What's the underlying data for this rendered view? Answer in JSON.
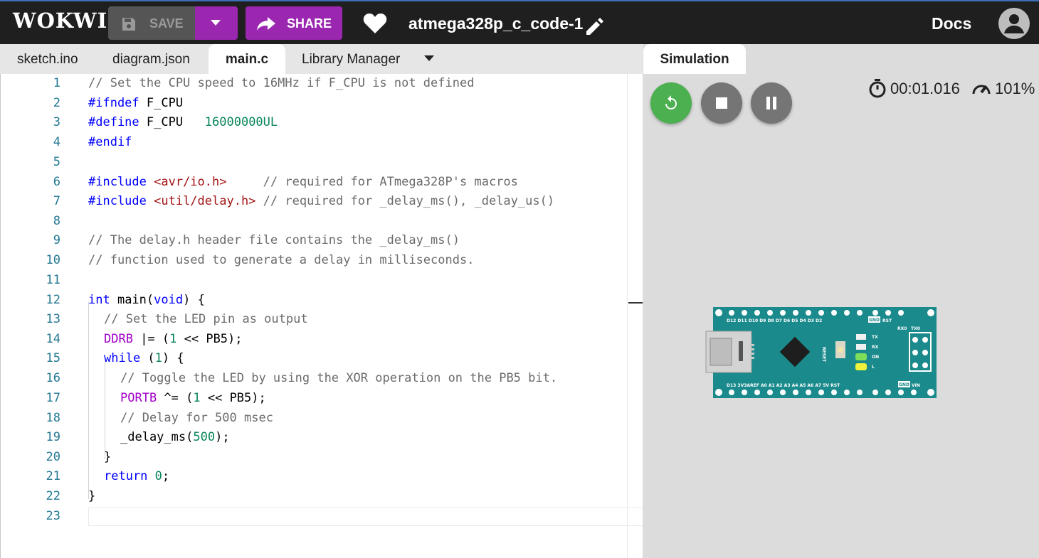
{
  "header": {
    "logo": "WOKWI",
    "save_label": "SAVE",
    "share_label": "SHARE",
    "project_title": "atmega328p_c_code-1",
    "docs_label": "Docs",
    "colors": {
      "bar": "#1f1f1f",
      "accent": "#9b27b0",
      "save_bg": "#555555"
    }
  },
  "editor": {
    "tabs": [
      {
        "label": "sketch.ino"
      },
      {
        "label": "diagram.json"
      },
      {
        "label": "main.c",
        "active": true
      },
      {
        "label": "Library Manager"
      }
    ],
    "line_numbers": [
      "1",
      "2",
      "3",
      "4",
      "5",
      "6",
      "7",
      "8",
      "9",
      "10",
      "11",
      "12",
      "13",
      "14",
      "15",
      "16",
      "17",
      "18",
      "19",
      "20",
      "21",
      "22",
      "23"
    ],
    "code": {
      "l1": "// Set the CPU speed to 16MHz if F_CPU is not defined",
      "l2a": "#ifndef",
      "l2b": " F_CPU",
      "l3a": "#define",
      "l3b": " F_CPU   ",
      "l3c": "16000000UL",
      "l4": "#endif",
      "l6a": "#include ",
      "l6b": "<avr/io.h>",
      "l6c": "     // required for ATmega328P's macros",
      "l7a": "#include ",
      "l7b": "<util/delay.h>",
      "l7c": " // required for _delay_ms(), _delay_us()",
      "l9": "// The delay.h header file contains the _delay_ms()",
      "l10": "// function used to generate a delay in milliseconds.",
      "l12a": "int",
      "l12b": " main(",
      "l12c": "void",
      "l12d": ") {",
      "l13": "// Set the LED pin as output",
      "l14a": "DDRB",
      "l14b": " |= (",
      "l14c": "1",
      "l14d": " << PB5);",
      "l15a": "while",
      "l15b": " (",
      "l15c": "1",
      "l15d": ") {",
      "l16": "// Toggle the LED by using the XOR operation on the PB5 bit.",
      "l17a": "PORTB",
      "l17b": " ^= (",
      "l17c": "1",
      "l17d": " << PB5);",
      "l18": "// Delay for 500 msec",
      "l19a": "_delay_ms(",
      "l19b": "500",
      "l19c": ");",
      "l20": "}",
      "l21a": "return",
      "l21b": " ",
      "l21c": "0",
      "l21d": ";",
      "l22": "}"
    }
  },
  "simulation": {
    "tab_label": "Simulation",
    "timer": "00:01.016",
    "speed": "101%",
    "board": {
      "name": "Arduino Nano",
      "top_pins": "D12 D11 D10 D9  D8  D7  D6  D5  D4  D3  D2",
      "top_gnd": "GND",
      "top_rst": "RST",
      "rx_label": "RX0",
      "tx_label": "TX0",
      "bottom_pins": "D13 3V3AREF A0  A1  A2  A3  A4  A5  A6  A7  5V  RST",
      "bottom_gnd": "GND",
      "bottom_vin": "VIN",
      "reset_label": "RESET",
      "led_tx": "TX",
      "led_rx": "RX",
      "led_on": "ON",
      "led_l": "L"
    },
    "colors": {
      "panel": "#dcdcdc",
      "restart": "#4caf50",
      "control": "#757575",
      "board": "#1b8a8c",
      "led_on": "#7ee05a",
      "led_l": "#eef23c"
    }
  }
}
